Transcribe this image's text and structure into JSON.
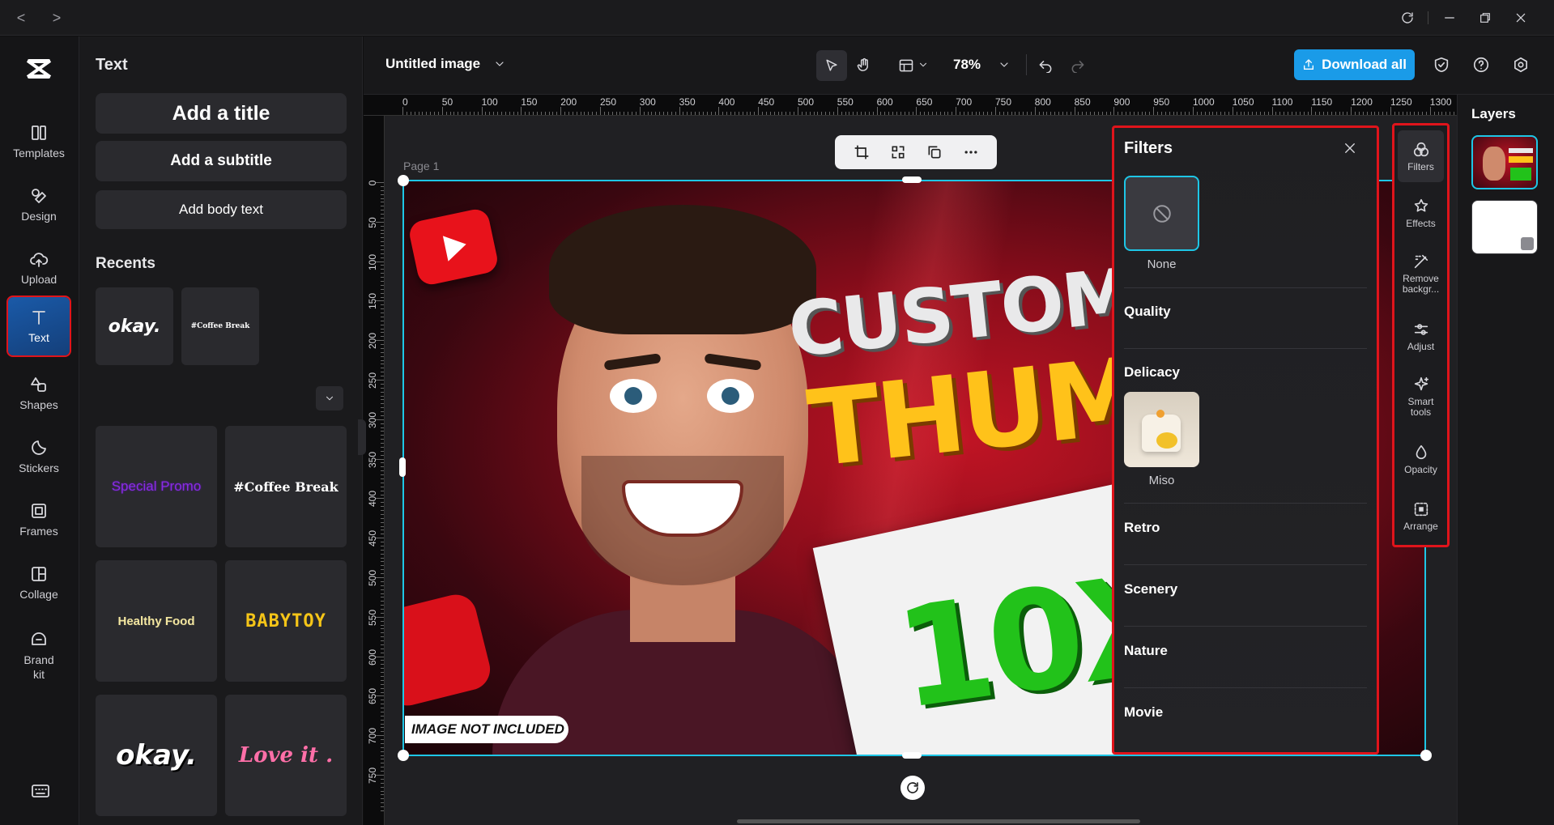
{
  "window": {
    "back": "<",
    "forward": ">"
  },
  "nav": {
    "items": [
      {
        "label": "Templates",
        "icon": "templates-icon"
      },
      {
        "label": "Design",
        "icon": "design-icon"
      },
      {
        "label": "Upload",
        "icon": "upload-icon"
      },
      {
        "label": "Text",
        "icon": "text-icon",
        "active": true
      },
      {
        "label": "Shapes",
        "icon": "shapes-icon"
      },
      {
        "label": "Stickers",
        "icon": "stickers-icon"
      },
      {
        "label": "Frames",
        "icon": "frames-icon"
      },
      {
        "label": "Collage",
        "icon": "collage-icon"
      },
      {
        "label": "Brand kit",
        "icon": "brand-kit-icon"
      }
    ]
  },
  "text_panel": {
    "title": "Text",
    "add_title": "Add a title",
    "add_subtitle": "Add a subtitle",
    "add_body": "Add body text",
    "recents_label": "Recents",
    "recents": [
      "okay.",
      "#Coffee Break"
    ],
    "styles": [
      "Special Promo",
      "#Coffee Break",
      "Healthy Food",
      "BABYTOY",
      "okay.",
      "Love it ."
    ]
  },
  "header": {
    "doc_title": "Untitled image",
    "zoom": "78%",
    "download_label": "Download all"
  },
  "ruler": {
    "h_ticks": [
      "0",
      "50",
      "100",
      "150",
      "200",
      "250",
      "300",
      "350",
      "400",
      "450",
      "500",
      "550",
      "600",
      "650",
      "700",
      "750",
      "800",
      "850",
      "900",
      "950",
      "1000",
      "1050",
      "1100",
      "1150",
      "1200",
      "1250",
      "1300"
    ],
    "v_ticks": [
      "0",
      "50",
      "100",
      "150",
      "200",
      "250",
      "300",
      "350",
      "400",
      "450",
      "500",
      "550",
      "600",
      "650",
      "700",
      "750"
    ]
  },
  "canvas": {
    "page_label": "Page 1",
    "thumb_text_1": "CUSTOM",
    "thumb_text_2": "THUM",
    "thumb_text_3": "10X",
    "thumb_badge": "IMAGE NOT INCLUDED"
  },
  "filters": {
    "title": "Filters",
    "none_label": "None",
    "sections": [
      "Quality",
      "Delicacy",
      "Retro",
      "Scenery",
      "Nature",
      "Movie"
    ],
    "delicacy_item": "Miso"
  },
  "tools": [
    {
      "label": "Filters",
      "icon": "filters-icon",
      "active": true
    },
    {
      "label": "Effects",
      "icon": "effects-icon"
    },
    {
      "label": "Remove backgr...",
      "icon": "remove-background-icon"
    },
    {
      "label": "Adjust",
      "icon": "adjust-icon"
    },
    {
      "label": "Smart tools",
      "icon": "smart-tools-icon"
    },
    {
      "label": "Opacity",
      "icon": "opacity-icon"
    },
    {
      "label": "Arrange",
      "icon": "arrange-icon"
    }
  ],
  "layers": {
    "title": "Layers"
  },
  "colors": {
    "accent": "#1a9be8",
    "highlight": "#e0141b",
    "selection": "#1ec6e6"
  }
}
